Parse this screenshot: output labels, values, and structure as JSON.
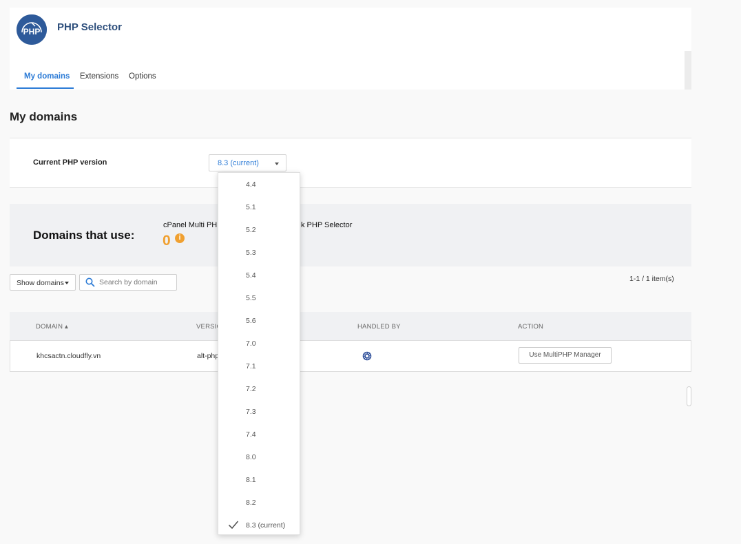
{
  "app": {
    "title": "PHP Selector",
    "logo_text": "PHP"
  },
  "tabs": [
    {
      "label": "My domains",
      "active": true
    },
    {
      "label": "Extensions",
      "active": false
    },
    {
      "label": "Options",
      "active": false
    }
  ],
  "page": {
    "title": "My domains"
  },
  "version": {
    "label": "Current PHP version",
    "selected": "8.3 (current)"
  },
  "dropdown": {
    "options": [
      "4.4",
      "5.1",
      "5.2",
      "5.3",
      "5.4",
      "5.5",
      "5.6",
      "7.0",
      "7.1",
      "7.2",
      "7.3",
      "7.4",
      "8.0",
      "8.1",
      "8.2",
      "8.3 (current)"
    ],
    "checked": "8.3 (current)"
  },
  "stats": {
    "label": "Domains that use:",
    "col1_title": "cPanel Multi PH",
    "col2_title": "k PHP Selector",
    "col1_count": "0",
    "info_icon": "i"
  },
  "controls": {
    "show_domains_label": "Show domains",
    "search_placeholder": "Search by domain",
    "pager_text": "1-1 / 1 item(s)"
  },
  "table": {
    "headers": {
      "domain": "DOMAIN ▴",
      "version": "VERSIO",
      "handled_by": "HANDLED BY",
      "action": "ACTION"
    },
    "rows": [
      {
        "domain": "khcsactn.cloudfly.vn",
        "version": "alt-php",
        "handled_by_icon": "cpanel-multiphp-icon",
        "action": "Use MultiPHP Manager"
      }
    ]
  },
  "colors": {
    "accent": "#2c7bd6",
    "brand": "#2e4f7c",
    "warning": "#f0a030"
  }
}
